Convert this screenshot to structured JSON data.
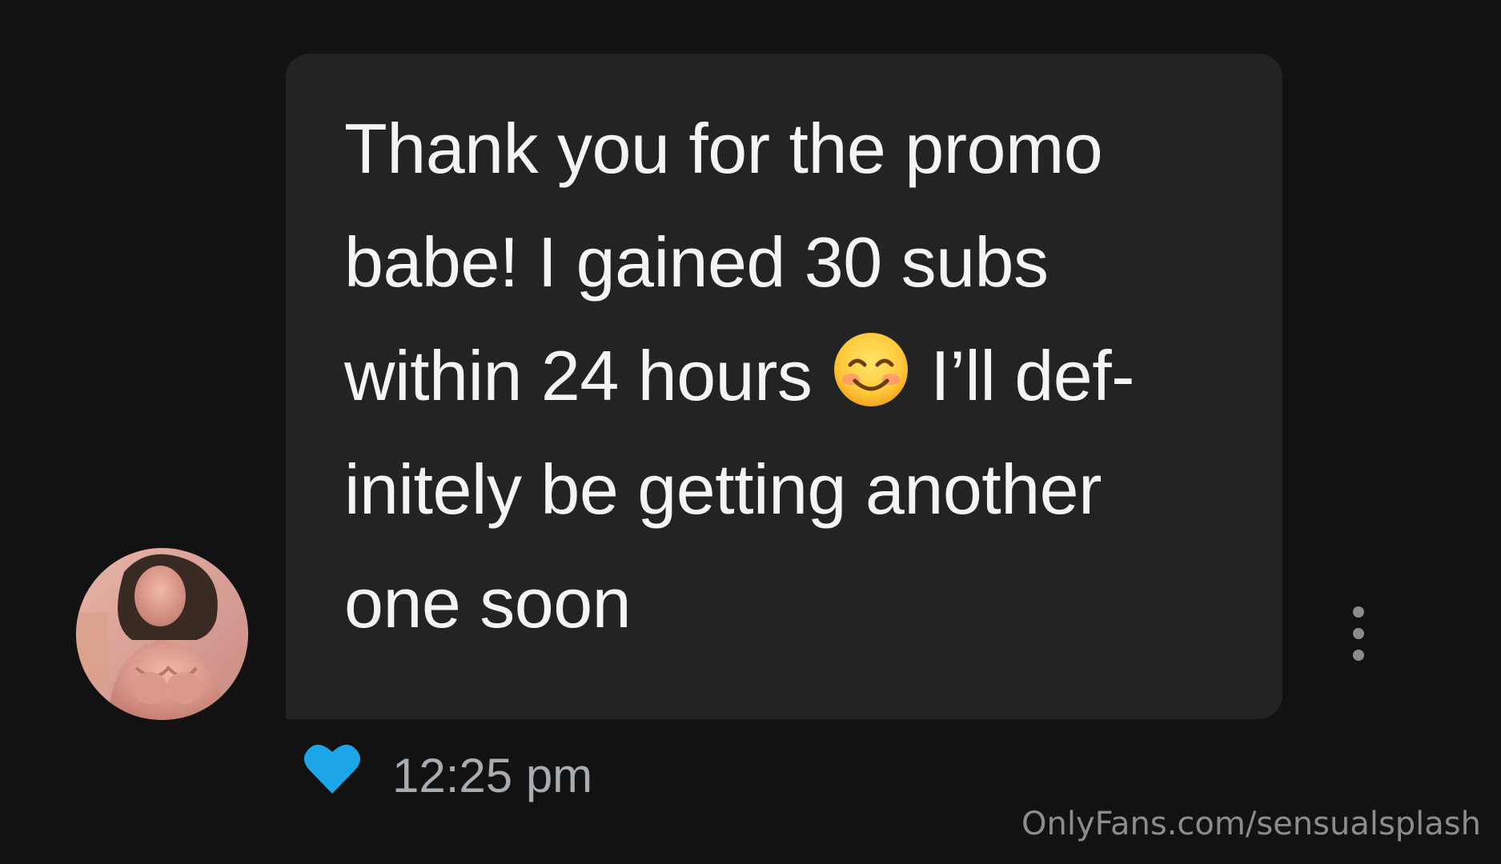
{
  "message": {
    "text": "Thank you for the promo\nbabe! I gained 30 subs\nwithin 24 hours ",
    "text_after_emoji": " I’ll def-\ninitely be getting another\none soon",
    "emoji": "smiling-face-with-smiling-eyes-icon",
    "timestamp": "12:25 pm",
    "liked": true
  },
  "watermark": "OnlyFans.com/sensualsplash",
  "colors": {
    "background": "#121212",
    "bubble": "#222325",
    "message_text": "#f4f4f4",
    "timestamp": "#a7acb1",
    "heart": "#1aa6e8",
    "watermark": "#8c8c8c"
  },
  "icons": {
    "like": "heart-icon",
    "more": "more-vertical-icon",
    "avatar": "avatar"
  }
}
